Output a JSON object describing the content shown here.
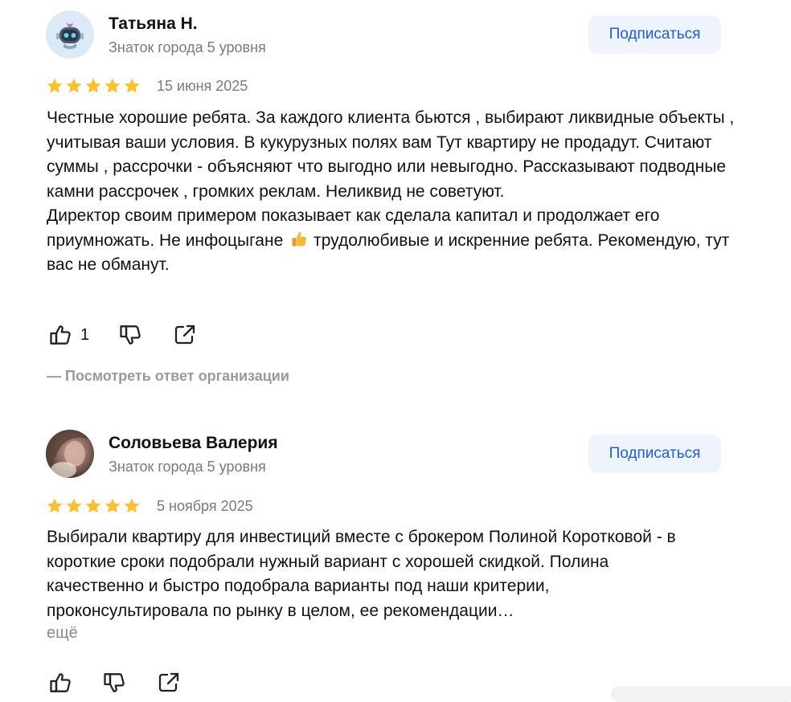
{
  "reviews": [
    {
      "author": "Татьяна Н.",
      "level": "Знаток города 5 уровня",
      "subscribe_label": "Подписаться",
      "rating": 5,
      "date": "15 июня 2025",
      "text_line1_before_emoji": "Честные хорошие ребята. За каждого клиента бьются , выбирают ликвидные объекты , учитывая ваши условия. В кукурузных полях вам Тут квартиру не продадут. Считают суммы , рассрочки - объясняют что выгодно или невыгодно. Рассказывают подводные камни рассрочек , громких реклам. Неликвид не советуют.",
      "text_para2_before_emoji": "Директор своим примером показывает как сделала капитал и продолжает его приумножать. Не инфоцыгане",
      "text_para2_after_emoji": "трудолюбивые и искренние ребята. Рекомендую, тут вас не обманут.",
      "emoji": "thumbs-up-emoji",
      "likes": "1",
      "org_reply_label": "—  Посмотреть ответ организации"
    },
    {
      "author": "Соловьева Валерия",
      "level": "Знаток города 5 уровня",
      "subscribe_label": "Подписаться",
      "rating": 5,
      "date": "5 ноября 2025",
      "text": "Выбирали квартиру для инвестиций вместе с брокером Полиной Коротковой - в короткие сроки подобрали нужный вариант с хорошей скидкой. Полина качественно и быстро подобрала варианты под наши критерии, проконсультировала по рынку в целом, ее рекомендации…",
      "more_label": "ещё"
    }
  ],
  "colors": {
    "star": "#fbc02d",
    "accent": "#1f5fd6",
    "subscribe_bg": "#eef3fc",
    "muted": "#7a7a7a"
  },
  "icons": [
    "robot-avatar-icon",
    "star-icon",
    "like-icon",
    "dislike-icon",
    "share-icon"
  ]
}
